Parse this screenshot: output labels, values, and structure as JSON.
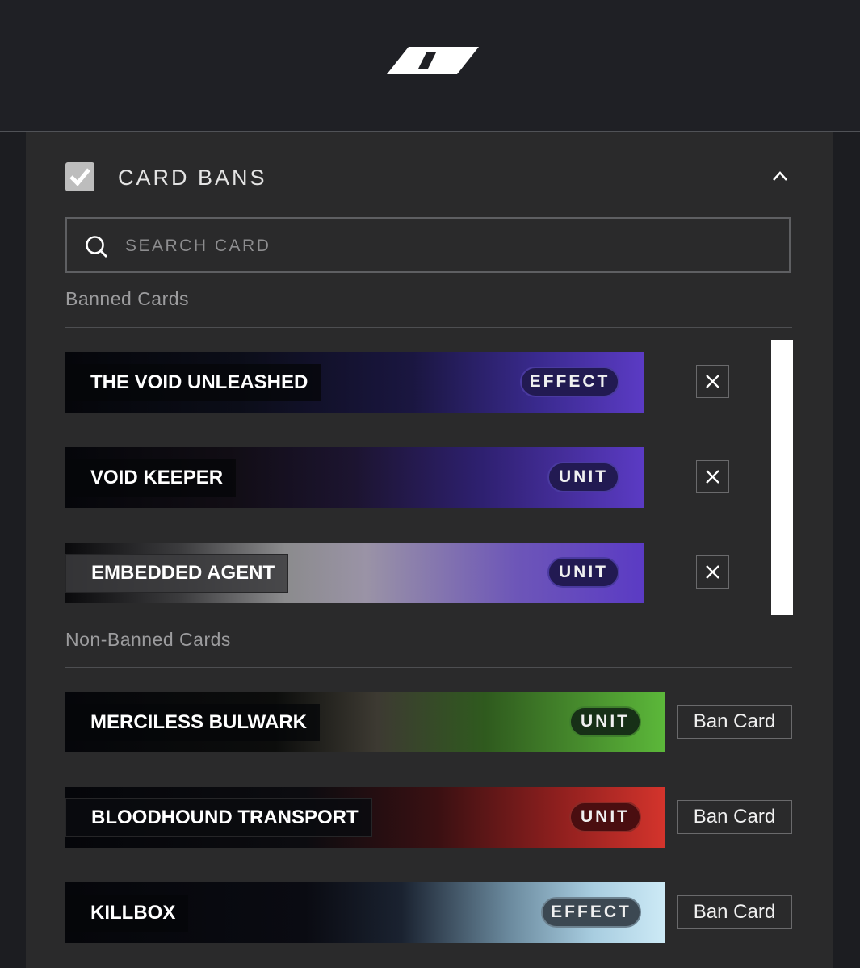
{
  "header": {
    "logo_icon": "brand-logo-icon"
  },
  "section": {
    "title": "CARD BANS",
    "checked": true
  },
  "search": {
    "placeholder": "SEARCH CARD",
    "value": ""
  },
  "banned": {
    "label": "Banned Cards",
    "cards": [
      {
        "name": "THE VOID UNLEASHED",
        "type": "EFFECT",
        "color": "#5b3bc4"
      },
      {
        "name": "VOID KEEPER",
        "type": "UNIT",
        "color": "#5b3bc4"
      },
      {
        "name": "EMBEDDED AGENT",
        "type": "UNIT",
        "color": "#5b3bc4"
      }
    ],
    "remove_icon": "close-icon"
  },
  "non_banned": {
    "label": "Non-Banned Cards",
    "button_label": "Ban Card",
    "cards": [
      {
        "name": "MERCILESS BULWARK",
        "type": "UNIT",
        "color": "#5cb83a"
      },
      {
        "name": "BLOODHOUND TRANSPORT",
        "type": "UNIT",
        "color": "#d4342c"
      },
      {
        "name": "KILLBOX",
        "type": "EFFECT",
        "color": "#cdeaf6"
      }
    ]
  }
}
